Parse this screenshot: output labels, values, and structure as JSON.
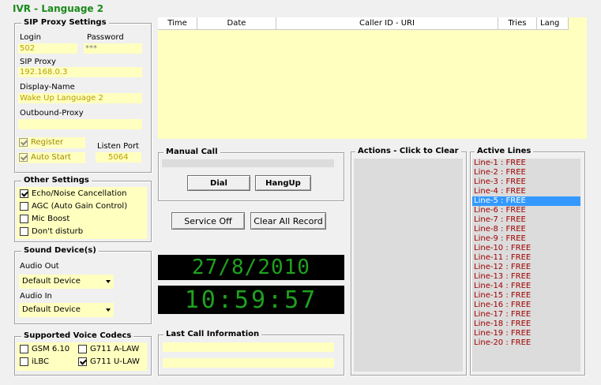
{
  "window": {
    "title": "IVR - Language 2"
  },
  "sip_proxy": {
    "title": "SIP Proxy Settings",
    "login_label": "Login",
    "login_value": "502",
    "password_label": "Password",
    "password_value": "***",
    "proxy_label": "SIP Proxy",
    "proxy_value": "192.168.0.3",
    "display_name_label": "Display-Name",
    "display_name_value": "Wake Up Language 2",
    "outbound_label": "Outbound-Proxy",
    "outbound_value": "",
    "register_label": "Register",
    "register_checked": true,
    "auto_start_label": "Auto Start",
    "auto_start_checked": true,
    "listen_port_label": "Listen Port",
    "listen_port_value": "5064"
  },
  "other_settings": {
    "title": "Other Settings",
    "options": [
      {
        "label": "Echo/Noise Cancellation",
        "checked": true
      },
      {
        "label": "AGC (Auto Gain Control)",
        "checked": false
      },
      {
        "label": "Mic Boost",
        "checked": false
      },
      {
        "label": "Don't disturb",
        "checked": false
      }
    ]
  },
  "sound_devices": {
    "title": "Sound Device(s)",
    "audio_out_label": "Audio Out",
    "audio_out_value": "Default Device",
    "audio_in_label": "Audio In",
    "audio_in_value": "Default Device"
  },
  "codecs": {
    "title": "Supported Voice Codecs",
    "gsm_label": "GSM 6.10",
    "gsm_checked": false,
    "alaw_label": "G711 A-LAW",
    "alaw_checked": false,
    "ilbc_label": "iLBC",
    "ilbc_checked": false,
    "ulaw_label": "G711 U-LAW",
    "ulaw_checked": true
  },
  "call_log": {
    "columns": [
      "Time",
      "Date",
      "Caller ID - URI",
      "Tries",
      "Lang"
    ]
  },
  "manual_call": {
    "title": "Manual Call",
    "dial_label": "Dial",
    "hangup_label": "HangUp"
  },
  "buttons": {
    "service_off": "Service Off",
    "clear_all": "Clear All Record"
  },
  "clock": {
    "date": "27/8/2010",
    "time": "10:59:57"
  },
  "last_call": {
    "title": "Last Call Information"
  },
  "actions": {
    "title": "Actions - Click to Clear"
  },
  "active_lines": {
    "title": "Active Lines",
    "selected_index": 4,
    "items": [
      "Line-1 : FREE",
      "Line-2 : FREE",
      "Line-3 : FREE",
      "Line-4 : FREE",
      "Line-5 : FREE",
      "Line-6 : FREE",
      "Line-7 : FREE",
      "Line-8 : FREE",
      "Line-9 : FREE",
      "Line-10 : FREE",
      "Line-11 : FREE",
      "Line-12 : FREE",
      "Line-13 : FREE",
      "Line-14 : FREE",
      "Line-15 : FREE",
      "Line-16 : FREE",
      "Line-17 : FREE",
      "Line-18 : FREE",
      "Line-19 : FREE",
      "Line-20 : FREE"
    ]
  },
  "colors": {
    "title_green": "#1a8a1a",
    "field_yellow": "#ffffc0",
    "led_green": "#1fa21f",
    "line_red": "#a00000",
    "selection_blue": "#3399ff"
  }
}
